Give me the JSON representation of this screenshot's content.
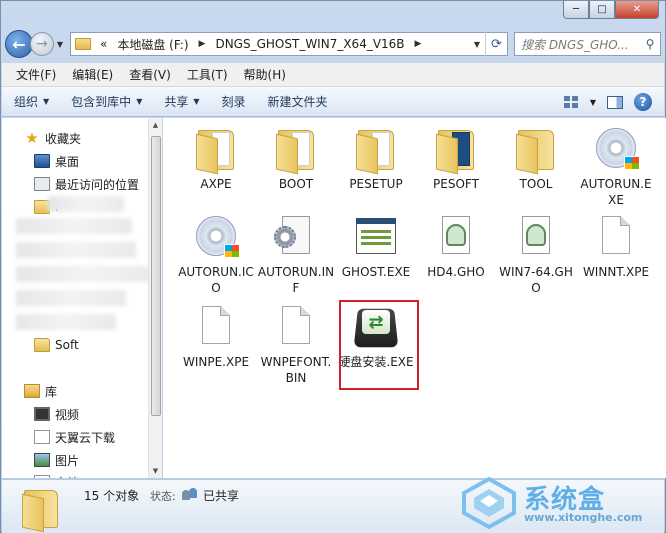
{
  "window": {
    "controls": [
      "─",
      "□",
      "✕"
    ]
  },
  "address": {
    "overflow": "«",
    "crumbs": [
      "本地磁盘 (F:)",
      "DNGS_GHOST_WIN7_X64_V16B"
    ],
    "search_placeholder": "搜索 DNGS_GHO..."
  },
  "menu": [
    "文件(F)",
    "编辑(E)",
    "查看(V)",
    "工具(T)",
    "帮助(H)"
  ],
  "toolbar": {
    "organize": "组织",
    "include_library": "包含到库中",
    "share": "共享",
    "burn": "刻录",
    "new_folder": "新建文件夹"
  },
  "nav": {
    "favorites": "收藏夹",
    "desktop": "桌面",
    "recent": "最近访问的位置",
    "partial_label": "I",
    "soft": "Soft",
    "libraries": "库",
    "videos": "视频",
    "tianyi": "天翼云下载",
    "pictures": "图片",
    "documents": "文档"
  },
  "files": [
    {
      "name": "AXPE",
      "type": "folder"
    },
    {
      "name": "BOOT",
      "type": "folder"
    },
    {
      "name": "PESETUP",
      "type": "folder"
    },
    {
      "name": "PESOFT",
      "type": "folder-blue"
    },
    {
      "name": "TOOL",
      "type": "folder"
    },
    {
      "name": "AUTORUN.EXE",
      "type": "cd"
    },
    {
      "name": "AUTORUN.ICO",
      "type": "cd"
    },
    {
      "name": "AUTORUN.INF",
      "type": "inf"
    },
    {
      "name": "GHOST.EXE",
      "type": "ghost"
    },
    {
      "name": "HD4.GHO",
      "type": "gho"
    },
    {
      "name": "WIN7-64.GHO",
      "type": "gho"
    },
    {
      "name": "WINNT.XPE",
      "type": "blank"
    },
    {
      "name": "WINPE.XPE",
      "type": "blank"
    },
    {
      "name": "WNPEFONT.BIN",
      "type": "blank"
    },
    {
      "name": "硬盘安装.EXE",
      "type": "exe"
    }
  ],
  "details": {
    "count": "15 个对象",
    "state_label": "状态:",
    "state_value": "已共享"
  },
  "watermark": {
    "brand": "系统盒",
    "url": "www.xitonghe.com"
  }
}
